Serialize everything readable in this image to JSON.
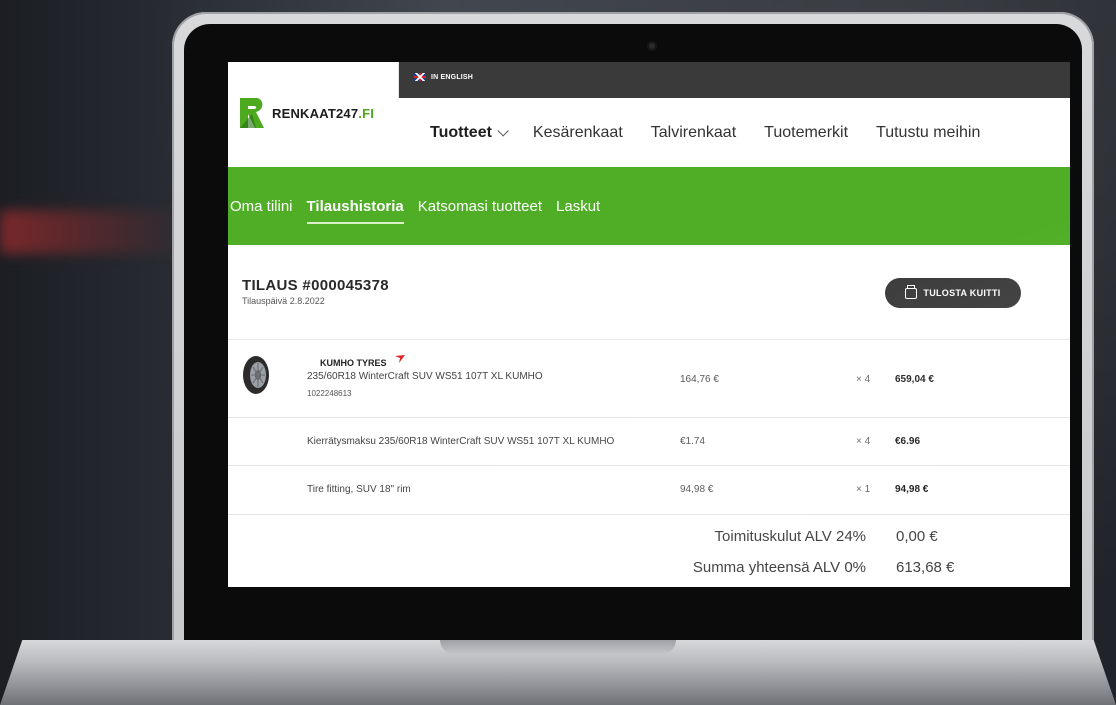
{
  "language_switch": {
    "label": "IN ENGLISH"
  },
  "brand": {
    "name": "RENKAAT247",
    "suffix": ".FI"
  },
  "main_nav": {
    "items": [
      {
        "label": "Tuotteet"
      },
      {
        "label": "Kesärenkaat"
      },
      {
        "label": "Talvirenkaat"
      },
      {
        "label": "Tuotemerkit"
      },
      {
        "label": "Tutustu meihin"
      }
    ]
  },
  "account_nav": {
    "items": [
      {
        "label": "Oma tilini",
        "active": false
      },
      {
        "label": "Tilaushistoria",
        "active": true
      },
      {
        "label": "Katsomasi tuotteet",
        "active": false
      },
      {
        "label": "Laskut",
        "active": false
      }
    ]
  },
  "order": {
    "title": "TILAUS #000045378",
    "date": "Tilauspäivä 2.8.2022",
    "print_label": "TULOSTA KUITTI",
    "lines": [
      {
        "brand": "KUMHO TYRES",
        "name": "235/60R18 WinterCraft SUV WS51 107T XL KUMHO",
        "sku": "1022248613",
        "unit_price": "164,76 €",
        "qty": "× 4",
        "total": "659,04 €"
      },
      {
        "name": "Kierrätysmaksu 235/60R18 WinterCraft SUV WS51 107T XL KUMHO",
        "unit_price": "€1.74",
        "qty": "× 4",
        "total": "€6.96"
      },
      {
        "name": "Tire fitting, SUV 18\" rim",
        "unit_price": "94,98 €",
        "qty": "× 1",
        "total": "94,98 €"
      }
    ],
    "summary": [
      {
        "label": "Toimituskulut ALV 24%",
        "value": "0,00 €"
      },
      {
        "label": "Summa yhteensä ALV 0%",
        "value": "613,68 €"
      }
    ]
  },
  "colors": {
    "brand_green": "#4fae26",
    "dark": "#3a3a3a"
  }
}
